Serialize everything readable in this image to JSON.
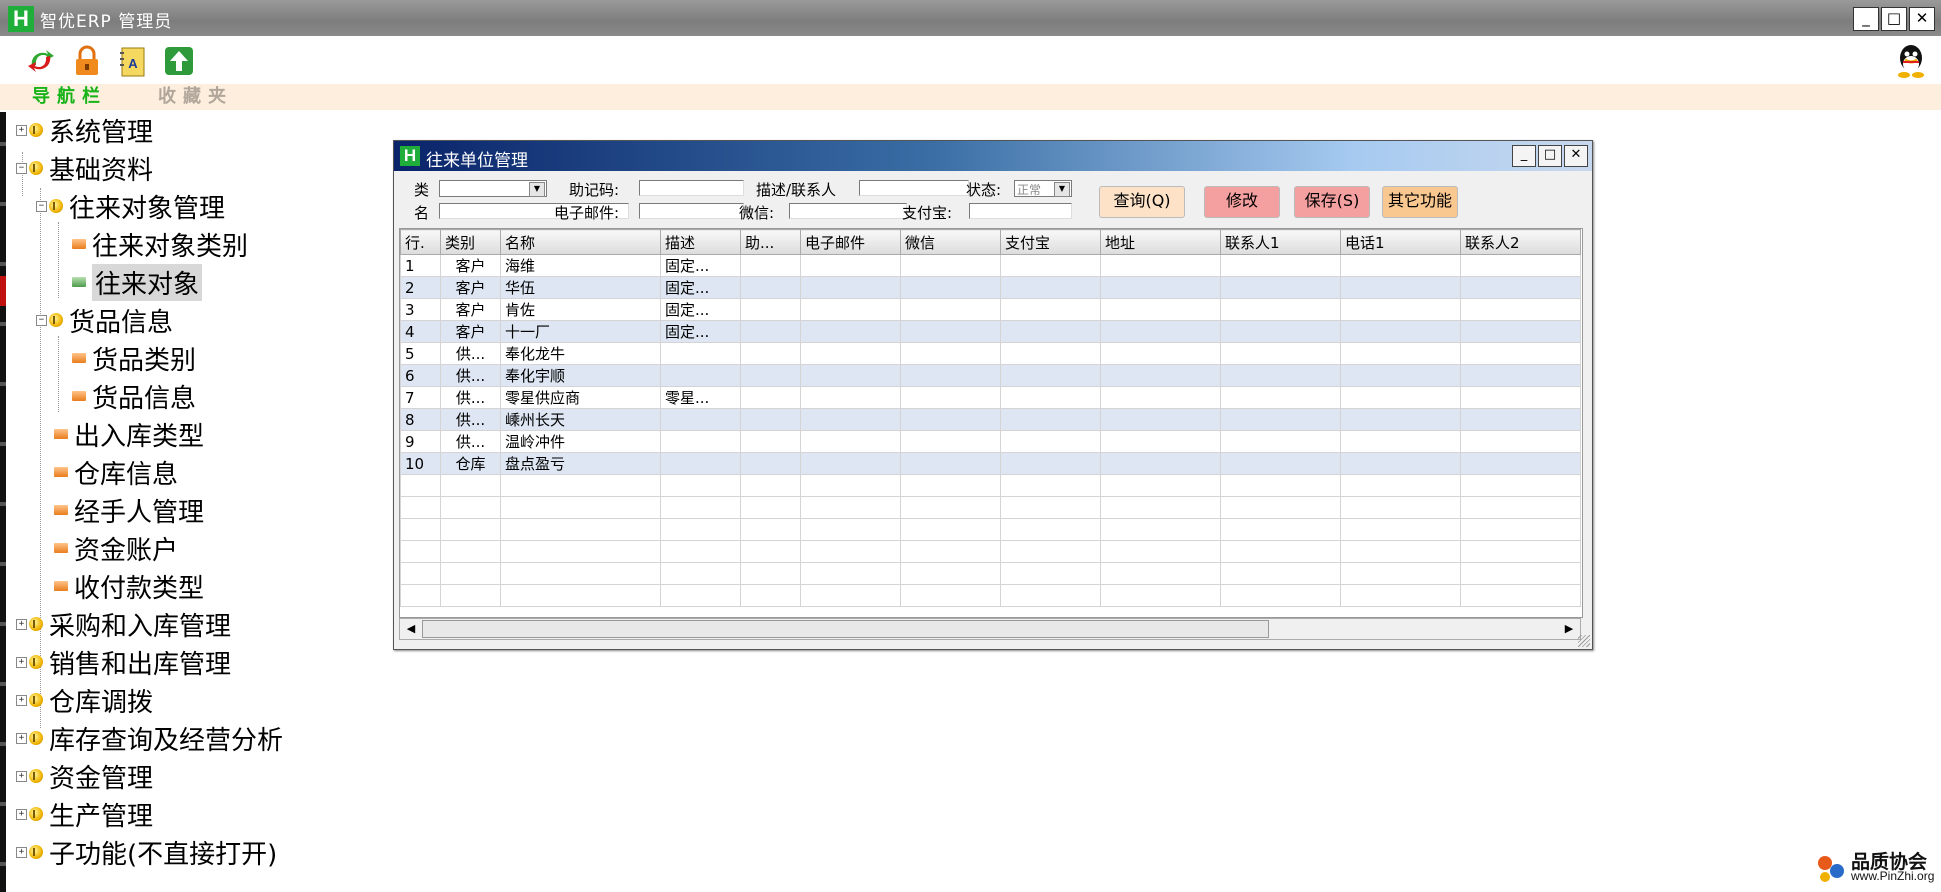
{
  "window": {
    "title": "智优ERP 管理员",
    "logo_letter": "H",
    "minimize": "_",
    "maximize": "□",
    "close": "✕"
  },
  "toolbar": {
    "icons": [
      "refresh-icon",
      "lock-icon",
      "notebook-icon",
      "upload-icon"
    ],
    "right_icon": "qq-icon"
  },
  "navtabs": {
    "active": "导航栏",
    "inactive": "收藏夹"
  },
  "tree": {
    "system": "系统管理",
    "basic": "基础资料",
    "partner_mgmt": "往来对象管理",
    "partner_category": "往来对象类别",
    "partner": "往来对象",
    "goods_info": "货品信息",
    "goods_category": "货品类别",
    "goods_info_leaf": "货品信息",
    "inout_type": "出入库类型",
    "warehouse": "仓库信息",
    "handler": "经手人管理",
    "fund_account": "资金账户",
    "payment_type": "收付款类型",
    "purchase": "采购和入库管理",
    "sales": "销售和出库管理",
    "transfer": "仓库调拨",
    "inventory": "库存查询及经营分析",
    "finance": "资金管理",
    "production": "生产管理",
    "subfunc": "子功能(不直接打开)"
  },
  "child_window": {
    "title": "往来单位管理",
    "logo_letter": "H",
    "minimize": "_",
    "maximize": "□",
    "close": "✕",
    "filters": {
      "category_label": "类",
      "mnemonic_label": "助记码:",
      "desc_contact_label": "描述/联系人",
      "status_label": "状态:",
      "status_value": "正常",
      "name_label": "名",
      "email_label": "电子邮件:",
      "wechat_label": "微信:",
      "alipay_label": "支付宝:"
    },
    "buttons": {
      "query": "查询(Q)",
      "edit": "修改",
      "save": "保存(S)",
      "other": "其它功能"
    },
    "columns": [
      "行.",
      "类别",
      "名称",
      "描述",
      "助...",
      "电子邮件",
      "微信",
      "支付宝",
      "地址",
      "联系人1",
      "电话1",
      "联系人2"
    ],
    "rows": [
      [
        "1",
        "客户",
        "海维",
        "固定..."
      ],
      [
        "2",
        "客户",
        "华伍",
        "固定..."
      ],
      [
        "3",
        "客户",
        "肯佐",
        "固定..."
      ],
      [
        "4",
        "客户",
        "十一厂",
        "固定..."
      ],
      [
        "5",
        "供...",
        "奉化龙牛",
        ""
      ],
      [
        "6",
        "供...",
        "奉化宇顺",
        ""
      ],
      [
        "7",
        "供...",
        "零星供应商",
        "零星..."
      ],
      [
        "8",
        "供...",
        "嵊州长天",
        ""
      ],
      [
        "9",
        "供...",
        "温岭冲件",
        ""
      ],
      [
        "10",
        "仓库",
        "盘点盈亏",
        ""
      ]
    ],
    "scroll_left": "◀",
    "scroll_right": "▶"
  },
  "watermark": {
    "line1": "品质协会",
    "line2": "www.PinZhi.org"
  },
  "colors": {
    "accent_green": "#18b318",
    "titlebar_gray": "#8a8a8a",
    "child_title_blue": "#0a246a",
    "row_alt": "#dde6f2",
    "btn_query": "#fde2c8",
    "btn_edit": "#f5a0a0",
    "btn_save": "#f5a0a0",
    "btn_other": "#f8c890"
  }
}
